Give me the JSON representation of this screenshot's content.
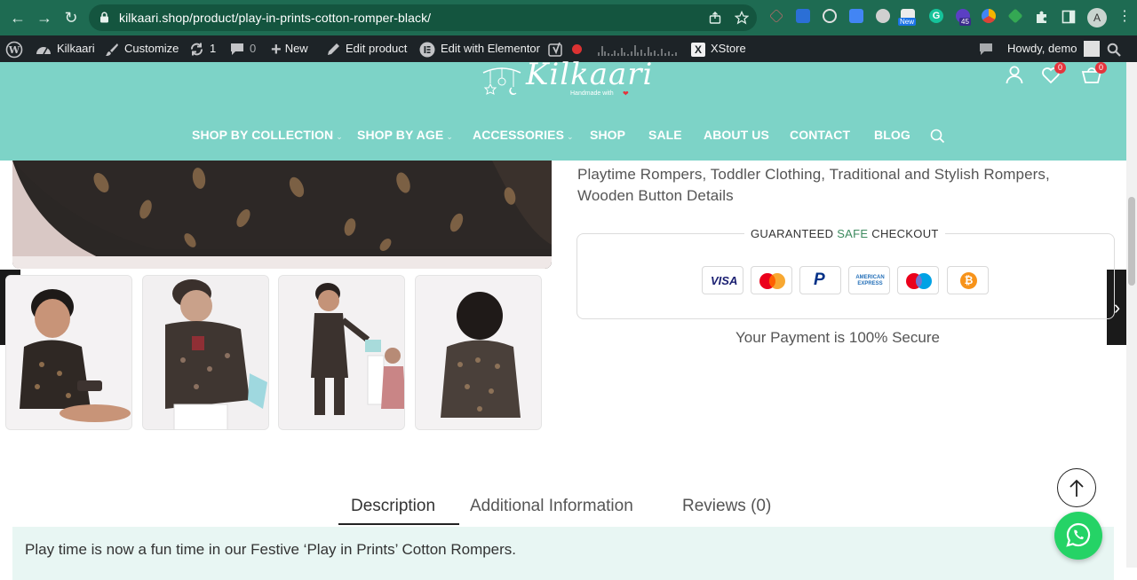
{
  "browser": {
    "url": "kilkaari.shop/product/play-in-prints-cotton-romper-black/",
    "extensions_badge_new": "New",
    "extensions_badge_count": "45",
    "profile_initial": "A"
  },
  "adminbar": {
    "site_name": "Kilkaari",
    "customize": "Customize",
    "updates_count": "1",
    "comments_count": "0",
    "new": "New",
    "edit_product": "Edit product",
    "edit_elementor": "Edit with Elementor",
    "xstore": "XStore",
    "howdy": "Howdy, demo"
  },
  "header": {
    "logo_text": "Kilkaari",
    "logo_tagline": "Handmade with",
    "wishlist_count": "0",
    "cart_count": "0",
    "menu": [
      {
        "label": "SHOP BY COLLECTION",
        "has_dropdown": true
      },
      {
        "label": "SHOP BY AGE",
        "has_dropdown": true
      },
      {
        "label": "ACCESSORIES",
        "has_dropdown": true
      },
      {
        "label": "SHOP",
        "has_dropdown": false
      },
      {
        "label": "SALE",
        "has_dropdown": false
      },
      {
        "label": "ABOUT US",
        "has_dropdown": false
      },
      {
        "label": "CONTACT",
        "has_dropdown": false
      },
      {
        "label": "BLOG",
        "has_dropdown": false
      }
    ],
    "dropdown_caret": "⌄"
  },
  "product": {
    "tags_line1": "Playtime Rompers, Toddler Clothing, Traditional and Stylish Rompers,",
    "tags_line2": "Wooden Button Details",
    "checkout": {
      "title_part1": "GUARANTEED ",
      "title_highlight": "SAFE",
      "title_part2": " CHECKOUT",
      "highlight_color": "#3c8a5e",
      "cards": [
        {
          "name": "visa",
          "label": "VISA"
        },
        {
          "name": "mastercard",
          "label": ""
        },
        {
          "name": "paypal",
          "label": "P"
        },
        {
          "name": "american-express",
          "label": "AMERICAN EXPRESS"
        },
        {
          "name": "maestro",
          "label": ""
        },
        {
          "name": "bitcoin",
          "label": "₿"
        }
      ],
      "secure_text": "Your Payment is 100% Secure"
    }
  },
  "tabs": [
    {
      "label": "Description",
      "active": true
    },
    {
      "label": "Additional Information",
      "active": false
    },
    {
      "label": "Reviews (0)",
      "active": false
    }
  ],
  "description": {
    "text": "Play time is now a fun time in our Festive ‘Play in Prints’ Cotton Rompers."
  },
  "colors": {
    "browser_bar": "#1e6b52",
    "header_teal": "#7dd3c7",
    "admin_bar": "#1d2327",
    "whatsapp": "#25d366",
    "badge_red": "#e5343d"
  },
  "icons": {
    "slider_prev": "‹",
    "slider_next": "›"
  }
}
